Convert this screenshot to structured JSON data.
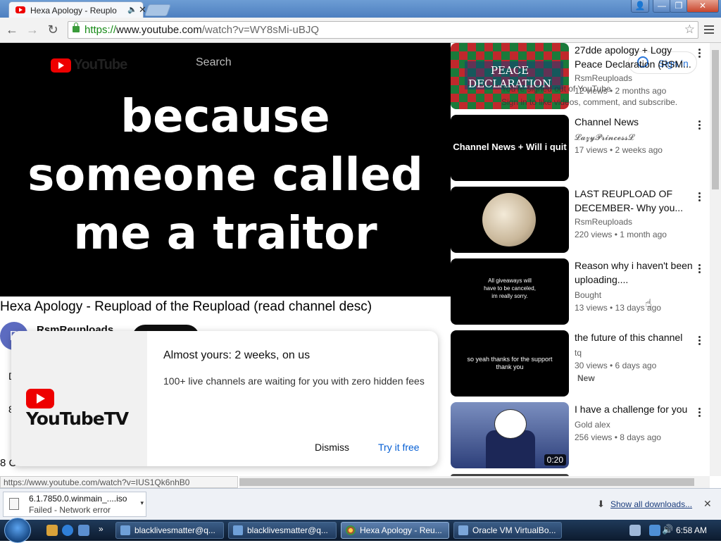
{
  "browser": {
    "tab_title": "Hexa Apology - Reuplo",
    "url_scheme": "https://",
    "url_host": "www.youtube.com",
    "url_path": "/watch?v=WY8sMi-uBJQ"
  },
  "player": {
    "logo_text": "YouTube",
    "search_label": "Search",
    "caption_line1": "because",
    "caption_line2": "someone called",
    "caption_line3": "me a traitor"
  },
  "video": {
    "title": "Hexa Apology - Reupload of the Reupload (read channel desc)",
    "channel": "RsmReuploads",
    "avatar_letter": "R",
    "peek_a": "D",
    "peek_b": "8",
    "comments_label": "8 Comments"
  },
  "signin_overlay": {
    "line1": "You're signed out of YouTube",
    "line2": "Sign in to like videos, comment, and subscribe.",
    "button": "Sign in"
  },
  "promo": {
    "logo_text": "YouTubeTV",
    "title": "Almost yours: 2 weeks, on us",
    "body": "100+ live channels are waiting for you with zero hidden fees",
    "dismiss": "Dismiss",
    "try": "Try it free"
  },
  "recommendations": [
    {
      "title": "27dde apology + Logy Peace Declaration (RSM...",
      "channel": "RsmReuploads",
      "meta": "12 views  • 2 months ago",
      "thumb_text": "PEACE DECLARATION",
      "duration": ""
    },
    {
      "title": "Channel News",
      "channel": "𝓛𝓪𝔃𝔂𝓟𝓻𝓲𝓷𝓬𝓮𝓼𝓼𝓛",
      "meta": "17 views  • 2 weeks ago",
      "thumb_text": "Channel News + Will i quit",
      "duration": ""
    },
    {
      "title": "LAST REUPLOAD OF DECEMBER- Why you...",
      "channel": "RsmReuploads",
      "meta": "220 views  • 1 month ago",
      "thumb_text": "",
      "duration": ""
    },
    {
      "title": "Reason why i haven't been uploading....",
      "channel": "Bought",
      "meta": "13 views  • 13 days ago",
      "thumb_text": "All giveaways will have to be canceled, im really sorry.",
      "duration": ""
    },
    {
      "title": "the future of this channel",
      "channel": "tq",
      "meta": "30 views  • 6 days ago",
      "badge": "New",
      "thumb_text": "so yeah thanks for the support thank you",
      "duration": ""
    },
    {
      "title": "I have a challenge for you",
      "channel": "Gold alex",
      "meta": "256 views  • 8 days ago",
      "thumb_text": "",
      "duration": "0:20"
    }
  ],
  "status_url": "https://www.youtube.com/watch?v=IUS1Qk6nhB0",
  "download": {
    "filename": "6.1.7850.0.winmain_....iso",
    "status": "Failed - Network error",
    "show_all": "Show all downloads..."
  },
  "taskbar": {
    "tasks": [
      "blacklivesmatter@q...",
      "blacklivesmatter@q...",
      "Hexa Apology - Reu...",
      "Oracle VM VirtualBo..."
    ],
    "clock": "6:58 AM"
  },
  "colors": {
    "youtube_red": "#ee0000",
    "link_blue": "#065fd4"
  }
}
